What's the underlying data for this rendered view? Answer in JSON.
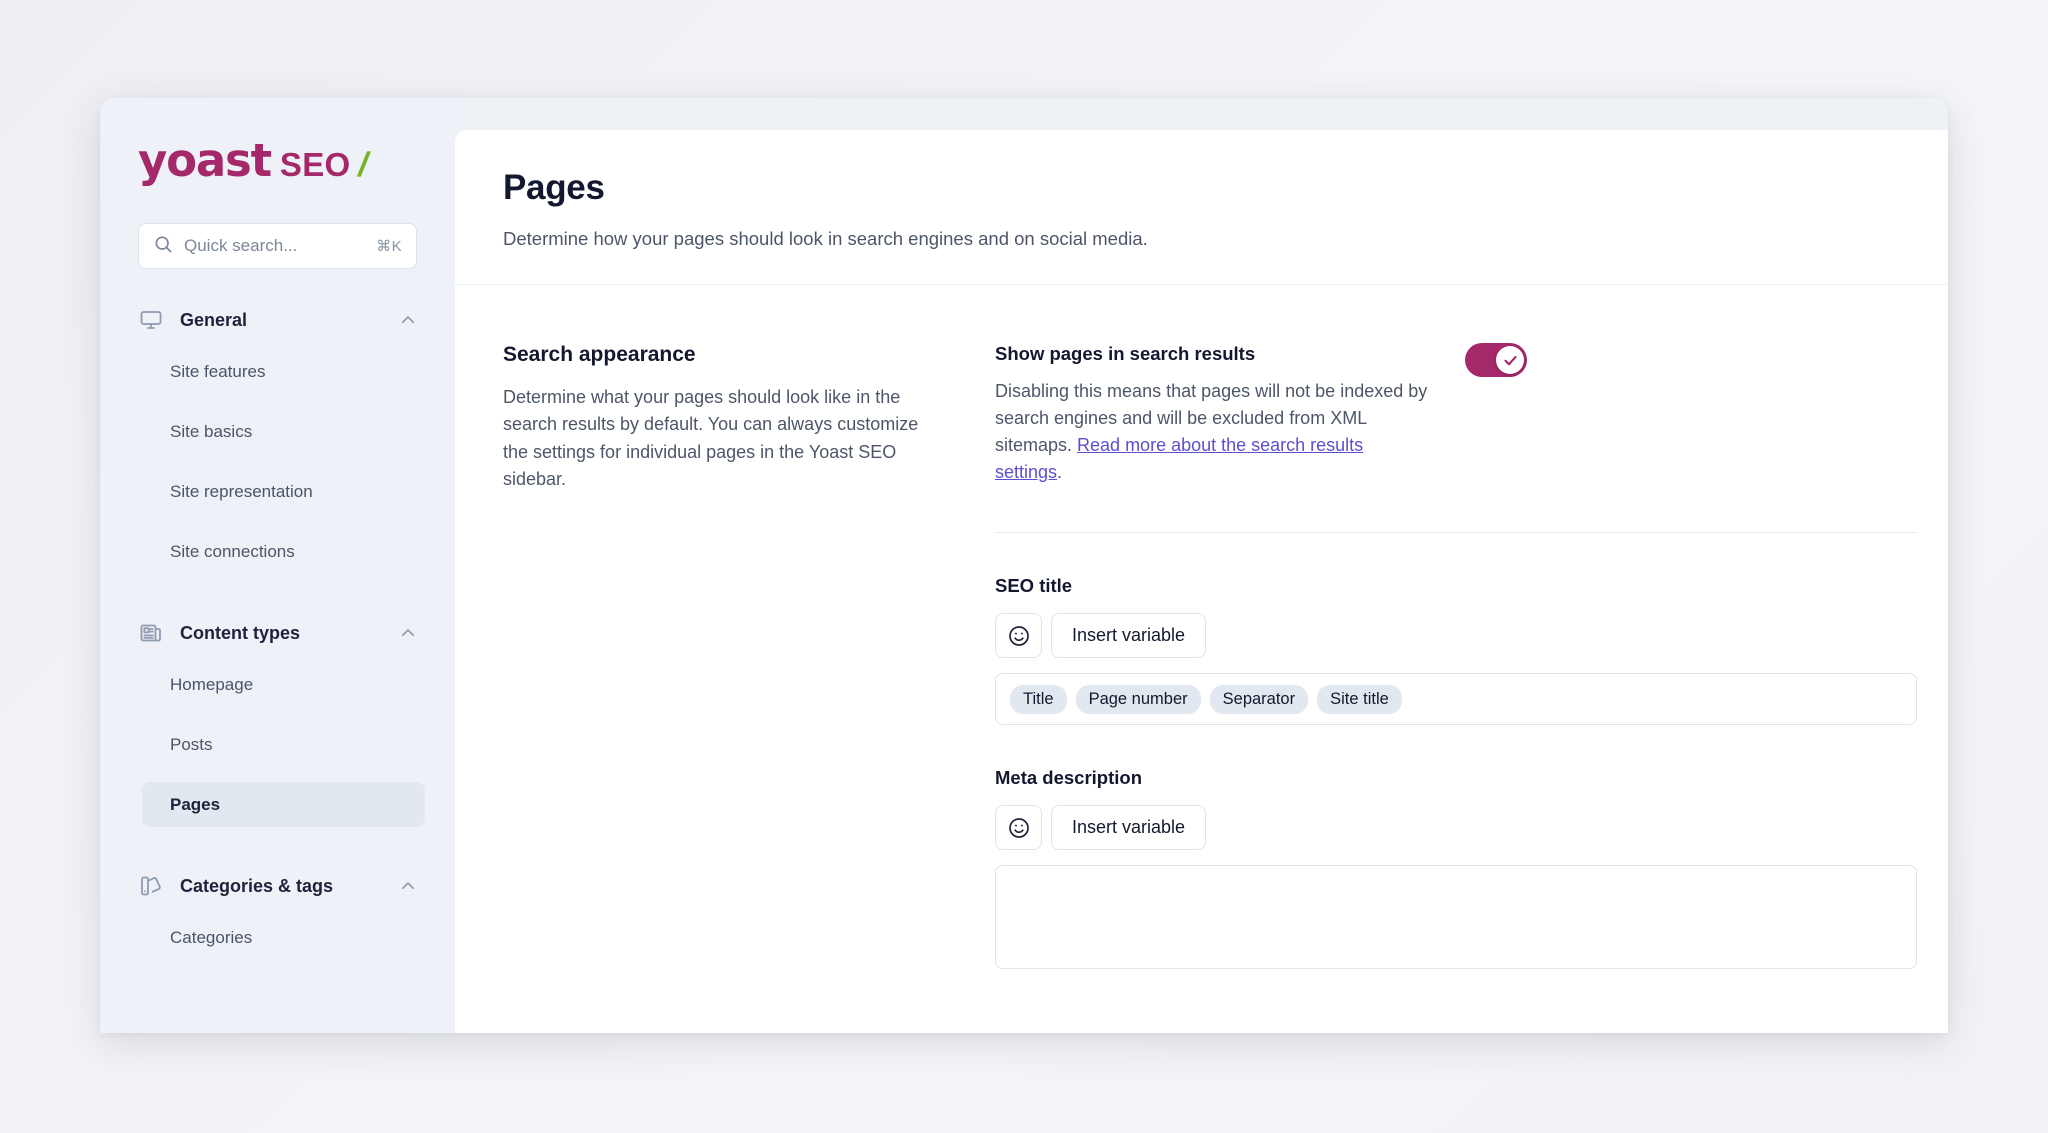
{
  "brand": {
    "logo_yoast": "yoast",
    "logo_seo": "SEO",
    "logo_slash": "/",
    "magenta": "#a4286a",
    "green": "#77b227"
  },
  "search": {
    "placeholder": "Quick search...",
    "shortcut": "⌘K",
    "icon": "search-icon"
  },
  "sidebar": {
    "groups": [
      {
        "label": "General",
        "icon": "monitor-icon",
        "expanded": true,
        "items": [
          {
            "label": "Site features",
            "active": false
          },
          {
            "label": "Site basics",
            "active": false
          },
          {
            "label": "Site representation",
            "active": false
          },
          {
            "label": "Site connections",
            "active": false
          }
        ]
      },
      {
        "label": "Content types",
        "icon": "newspaper-icon",
        "expanded": true,
        "items": [
          {
            "label": "Homepage",
            "active": false
          },
          {
            "label": "Posts",
            "active": false
          },
          {
            "label": "Pages",
            "active": true
          }
        ]
      },
      {
        "label": "Categories & tags",
        "icon": "tags-icon",
        "expanded": true,
        "items": [
          {
            "label": "Categories",
            "active": false
          }
        ]
      }
    ]
  },
  "header": {
    "title": "Pages",
    "subtitle": "Determine how your pages should look in search engines and on social media."
  },
  "search_appearance": {
    "section_title": "Search appearance",
    "section_description": "Determine what your pages should look like in the search results by default. You can always customize the settings for individual pages in the Yoast SEO sidebar."
  },
  "show_in_search": {
    "label": "Show pages in search results",
    "help_prefix": "Disabling this means that pages will not be indexed by search engines and will be excluded from XML sitemaps. ",
    "link_text": "Read more about the search results settings",
    "help_suffix": ".",
    "toggle_on": true
  },
  "seo_title": {
    "label": "SEO title",
    "emoji_button": "emoji-picker-icon",
    "insert_variable_label": "Insert variable",
    "tokens": [
      "Title",
      "Page number",
      "Separator",
      "Site title"
    ]
  },
  "meta_description": {
    "label": "Meta description",
    "emoji_button": "emoji-picker-icon",
    "insert_variable_label": "Insert variable",
    "value": ""
  }
}
